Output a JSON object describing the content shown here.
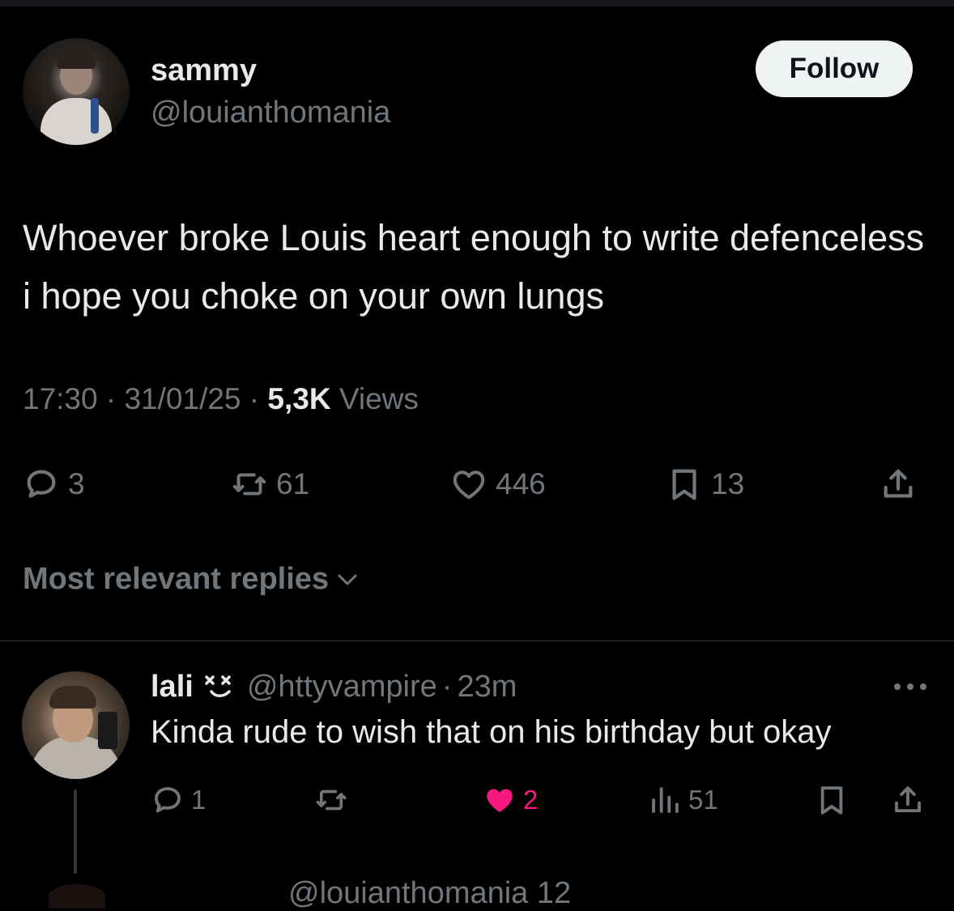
{
  "tweet": {
    "author_name": "sammy",
    "author_handle": "@louianthomania",
    "follow_label": "Follow",
    "text": "Whoever broke Louis heart enough to write defenceless i hope you choke on your own lungs",
    "time": "17:30",
    "date": "31/01/25",
    "views_count": "5,3K",
    "views_label": "Views",
    "separator": "·",
    "replies": "3",
    "reposts": "61",
    "likes": "446",
    "bookmarks": "13"
  },
  "replies_filter": {
    "label": "Most relevant replies"
  },
  "reply": {
    "name": "lali",
    "handle": "@httyvampire",
    "time": "23m",
    "separator": "·",
    "text": "Kinda rude to wish that on his birthday but okay",
    "replies": "1",
    "likes": "2",
    "views": "51"
  },
  "next_reply_partial": {
    "text": "@louianthomania 12"
  },
  "icons": {
    "reply": "comment-icon",
    "repost": "repost-icon",
    "like": "heart-icon",
    "bookmark": "bookmark-icon",
    "share": "share-icon",
    "views": "bar-chart-icon",
    "more": "more-icon",
    "chevron": "chevron-down-icon",
    "emoji": "dizzy-face-emoji-icon"
  },
  "colors": {
    "background": "#000000",
    "text": "#e7e9ea",
    "muted": "#71767b",
    "like_active": "#f91880",
    "follow_bg": "#eff3f4"
  }
}
